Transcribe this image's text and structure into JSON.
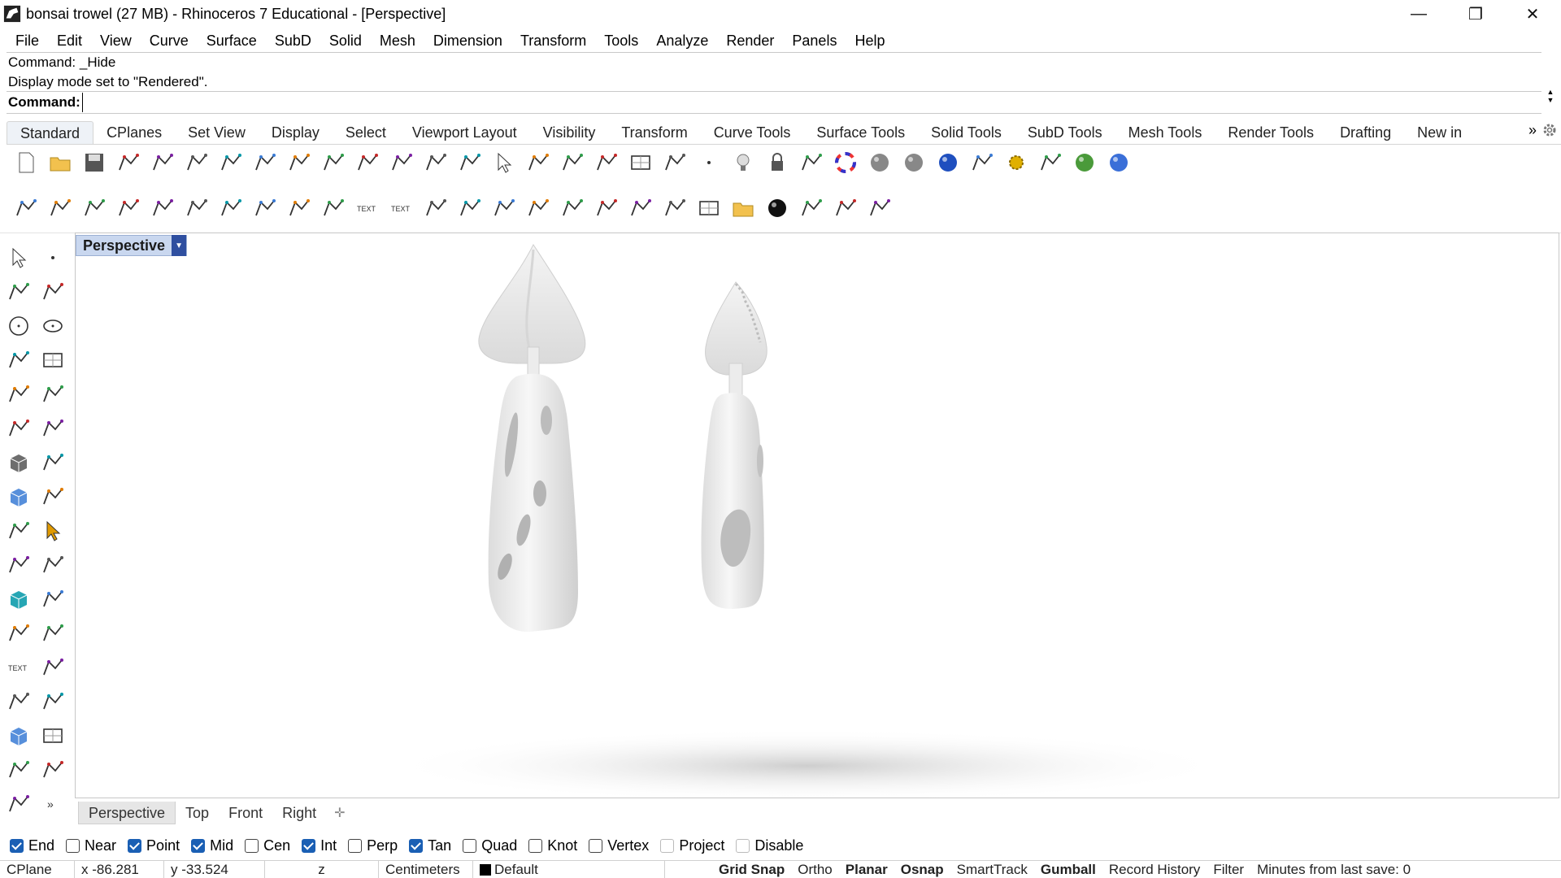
{
  "window": {
    "title": "bonsai trowel (27 MB) - Rhinoceros 7 Educational - [Perspective]",
    "controls": {
      "minimize": "—",
      "restore": "❐",
      "close": "✕"
    }
  },
  "menu": [
    "File",
    "Edit",
    "View",
    "Curve",
    "Surface",
    "SubD",
    "Solid",
    "Mesh",
    "Dimension",
    "Transform",
    "Tools",
    "Analyze",
    "Render",
    "Panels",
    "Help"
  ],
  "command": {
    "history": [
      "Command: _Hide",
      "Display mode set to \"Rendered\"."
    ],
    "prompt": "Command:",
    "value": ""
  },
  "toolbar_tabs": [
    "Standard",
    "CPlanes",
    "Set View",
    "Display",
    "Select",
    "Viewport Layout",
    "Visibility",
    "Transform",
    "Curve Tools",
    "Surface Tools",
    "Solid Tools",
    "SubD Tools",
    "Mesh Tools",
    "Render Tools",
    "Drafting",
    "New in"
  ],
  "toolbar_tabs_more": "»",
  "toolbar_row1_icons": [
    "new-file-icon",
    "open-folder-icon",
    "save-icon",
    "print-icon",
    "import-icon",
    "cut-icon",
    "copy-icon",
    "paste-icon",
    "undo-icon",
    "pan-hand-icon",
    "rotate-view-icon",
    "zoom-in-icon",
    "zoom-window-icon",
    "zoom-extents-icon",
    "zoom-selected-icon",
    "rotate-camera-icon",
    "four-viewports-icon",
    "car-properties-icon",
    "grid-icon",
    "cplane-icon",
    "point-filter-icon",
    "light-bulb-icon",
    "lock-icon",
    "layer-icon",
    "color-wheel-icon",
    "shaded-sphere-icon",
    "wireframe-sphere-icon",
    "rendered-sphere-icon",
    "filter-icon",
    "gear-options-icon",
    "dimension-tools-icon",
    "render-globe-icon",
    "help-icon"
  ],
  "toolbar_row2_icons": [
    "linear-dim-icon",
    "aligned-dim-icon",
    "rotated-dim-icon",
    "angle-dim-icon",
    "angle-dim-2-icon",
    "angle-45-icon",
    "radius-dim-icon",
    "diameter-dim-icon",
    "center-mark-icon",
    "fold-icon",
    "text-icon",
    "text-2-icon",
    "leader-icon",
    "leader-2-icon",
    "ordinate-icon",
    "cloud-icon",
    "hatch-icon",
    "clipping-icon",
    "measure-icon",
    "rotate-3d-icon",
    "table-icon",
    "open-folder-2-icon",
    "black-sphere-icon",
    "spiral-icon",
    "scale-icon",
    "trim-icon"
  ],
  "left_tools": [
    [
      "select-arrow-icon",
      "point-icon"
    ],
    [
      "polyline-icon",
      "curve-icon"
    ],
    [
      "circle-icon",
      "ellipse-icon"
    ],
    [
      "arc-icon",
      "rectangle-icon"
    ],
    [
      "polygon-icon",
      "fillet-curve-icon"
    ],
    [
      "surface-icon",
      "loft-icon"
    ],
    [
      "box-icon",
      "boolean-union-icon"
    ],
    [
      "cylinder-icon",
      "extrude-surface-icon"
    ],
    [
      "mesh-explode-icon",
      "arrow-pointer-icon"
    ],
    [
      "split-icon",
      "trim-tool-icon"
    ],
    [
      "solid-group-icon",
      "explode-icon"
    ],
    [
      "offset-curve-icon",
      "blend-curve-icon"
    ],
    [
      "text-tool-icon",
      "scale-tool-icon"
    ],
    [
      "array-icon",
      "mirror-icon"
    ],
    [
      "dim-box-icon",
      "grid-plane-icon"
    ],
    [
      "polar-array-icon",
      "gumball-icon"
    ],
    [
      "patch-icon",
      "expand-more-icon"
    ]
  ],
  "viewport": {
    "label": "Perspective",
    "dropdown": "▼"
  },
  "viewport_tabs": [
    "Perspective",
    "Top",
    "Front",
    "Right"
  ],
  "viewport_tab_add": "✛",
  "osnaps": [
    {
      "label": "End",
      "checked": true
    },
    {
      "label": "Near",
      "checked": false
    },
    {
      "label": "Point",
      "checked": true
    },
    {
      "label": "Mid",
      "checked": true
    },
    {
      "label": "Cen",
      "checked": false
    },
    {
      "label": "Int",
      "checked": true
    },
    {
      "label": "Perp",
      "checked": false
    },
    {
      "label": "Tan",
      "checked": true
    },
    {
      "label": "Quad",
      "checked": false
    },
    {
      "label": "Knot",
      "checked": false
    },
    {
      "label": "Vertex",
      "checked": false
    },
    {
      "label": "Project",
      "checked": false,
      "faint": true
    },
    {
      "label": "Disable",
      "checked": false,
      "faint": true
    }
  ],
  "status": {
    "cplane": "CPlane",
    "x": "x -86.281",
    "y": "y -33.524",
    "z": "z",
    "units": "Centimeters",
    "layer": "Default",
    "toggles": [
      {
        "label": "Grid Snap",
        "bold": true
      },
      {
        "label": "Ortho",
        "bold": false
      },
      {
        "label": "Planar",
        "bold": true
      },
      {
        "label": "Osnap",
        "bold": true
      },
      {
        "label": "SmartTrack",
        "bold": false
      },
      {
        "label": "Gumball",
        "bold": true
      },
      {
        "label": "Record History",
        "bold": false
      },
      {
        "label": "Filter",
        "bold": false
      }
    ],
    "save_info": "Minutes from last save: 0"
  }
}
